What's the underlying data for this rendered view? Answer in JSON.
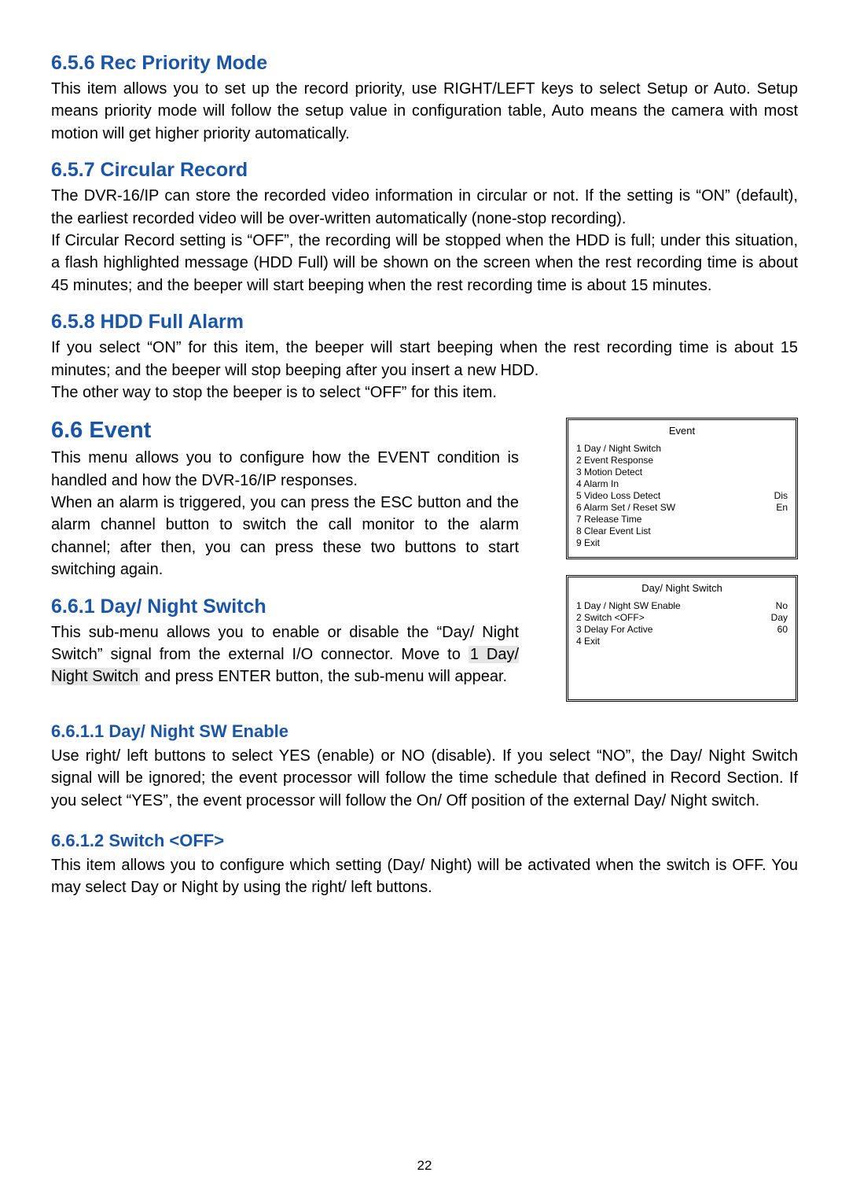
{
  "pageNumber": "22",
  "sections": {
    "recPriority": {
      "heading": "6.5.6 Rec Priority Mode",
      "body": "This item allows you to set up the record priority, use RIGHT/LEFT keys to select Setup or Auto. Setup means priority mode will follow the setup value in configuration table, Auto means the camera with most motion will get higher priority automatically."
    },
    "circular": {
      "heading": "6.5.7 Circular Record",
      "body1": "The DVR-16/IP can store the recorded video information in circular or not. If the setting is “ON” (default), the earliest recorded video will be over-written automatically (none-stop recording).",
      "body2": "If Circular Record setting is “OFF”, the recording will be stopped when the HDD is full; under this situation, a flash highlighted message (HDD Full) will be shown on the screen when the rest recording time is about 45 minutes; and the beeper will start beeping when the rest recording time is about 15 minutes."
    },
    "hddFull": {
      "heading": "6.5.8 HDD Full Alarm",
      "body1": "If you select “ON” for this item, the beeper will start beeping when the rest recording time is about 15 minutes; and the beeper will stop beeping after you insert a new HDD.",
      "body2": "The other way to stop the beeper is to select “OFF” for this item."
    },
    "event": {
      "heading": "6.6 Event",
      "body1": "This menu allows you to configure how the EVENT condition is handled and how the DVR-16/IP responses.",
      "body2": "When an alarm is triggered, you can press the ESC button and the alarm channel button to switch the call monitor to the alarm channel; after then, you can press these two buttons to start switching again."
    },
    "dayNight": {
      "heading": "6.6.1 Day/ Night Switch",
      "body_pre": "This sub-menu allows you to enable or disable the “Day/ Night Switch” signal from the external I/O connector. Move to ",
      "body_hl": "1 Day/ Night Switch",
      "body_post": " and press ENTER button, the sub-menu will appear."
    },
    "swEnable": {
      "heading": "6.6.1.1 Day/ Night SW Enable",
      "body": "Use right/ left buttons to select YES (enable) or NO (disable). If you select “NO”, the Day/ Night Switch signal will be ignored; the event processor will follow the time schedule that defined in Record Section. If you select “YES”, the event processor will follow the On/ Off position of the external Day/ Night switch."
    },
    "switchOff": {
      "heading": "6.6.1.2 Switch <OFF>",
      "body": "This item allows you to configure which setting (Day/ Night) will be activated when the switch is OFF. You may select Day or Night by using the right/ left buttons."
    }
  },
  "eventPanel": {
    "title": "Event",
    "items": [
      {
        "label": "1 Day / Night Switch",
        "value": ""
      },
      {
        "label": "2 Event Response",
        "value": ""
      },
      {
        "label": "3 Motion Detect",
        "value": ""
      },
      {
        "label": "4 Alarm In",
        "value": ""
      },
      {
        "label": "5 Video Loss Detect",
        "value": "Dis"
      },
      {
        "label": "6 Alarm Set / Reset SW",
        "value": "En"
      },
      {
        "label": "7 Release Time",
        "value": ""
      },
      {
        "label": "8 Clear Event List",
        "value": ""
      },
      {
        "label": "9 Exit",
        "value": ""
      }
    ]
  },
  "dnsPanel": {
    "title": "Day/ Night Switch",
    "items": [
      {
        "label": "1 Day / Night SW Enable",
        "value": "No"
      },
      {
        "label": "2 Switch <OFF>",
        "value": "Day"
      },
      {
        "label": "3 Delay For Active",
        "value": "60"
      },
      {
        "label": "4 Exit",
        "value": ""
      }
    ],
    "padHeight": "56px"
  }
}
